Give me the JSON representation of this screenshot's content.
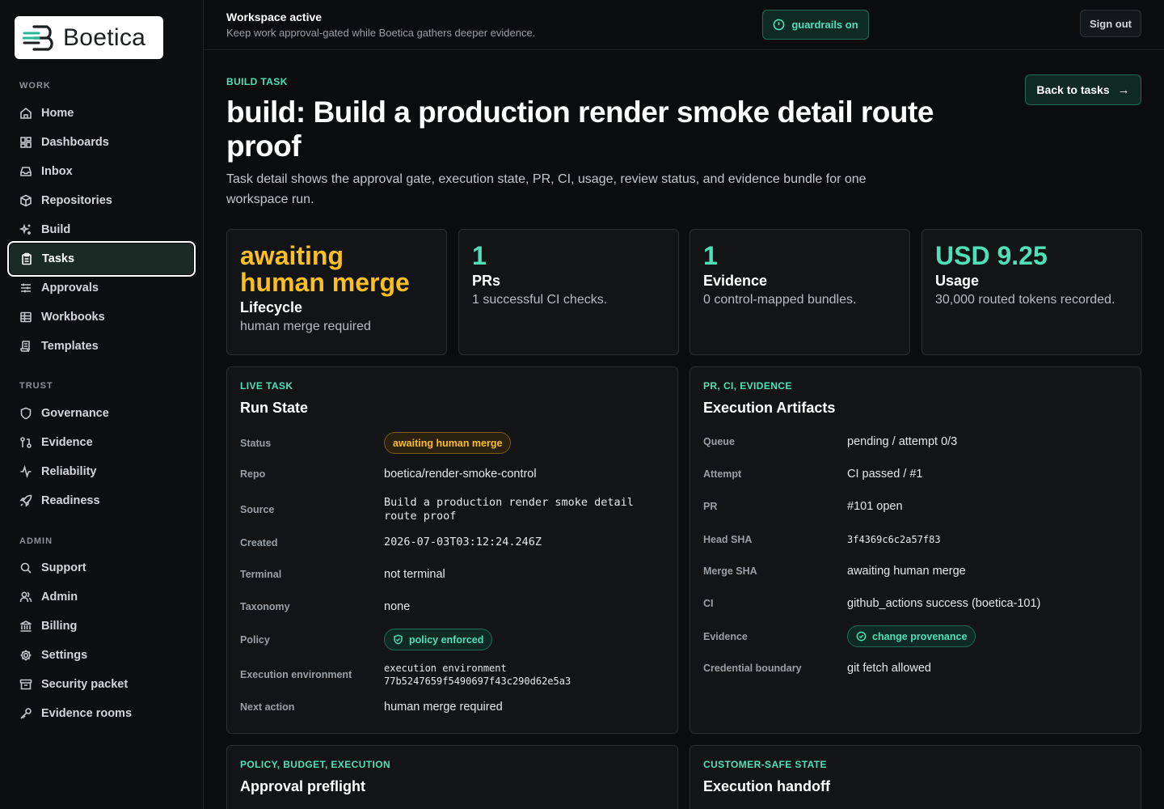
{
  "brand": {
    "name": "Boetica"
  },
  "sidebar": {
    "sections": [
      {
        "label": "WORK"
      },
      {
        "label": "TRUST"
      },
      {
        "label": "ADMIN"
      }
    ],
    "items": [
      {
        "label": "Home",
        "icon": "home-icon"
      },
      {
        "label": "Dashboards",
        "icon": "dashboard-icon"
      },
      {
        "label": "Inbox",
        "icon": "inbox-icon"
      },
      {
        "label": "Repositories",
        "icon": "box-icon"
      },
      {
        "label": "Build",
        "icon": "sparkles-icon"
      },
      {
        "label": "Tasks",
        "icon": "clipboard-icon",
        "active": true
      },
      {
        "label": "Approvals",
        "icon": "sliders-icon"
      },
      {
        "label": "Workbooks",
        "icon": "table-icon"
      },
      {
        "label": "Templates",
        "icon": "scroll-icon"
      },
      {
        "label": "Governance",
        "icon": "shield-icon"
      },
      {
        "label": "Evidence",
        "icon": "git-compare-icon"
      },
      {
        "label": "Reliability",
        "icon": "activity-icon"
      },
      {
        "label": "Readiness",
        "icon": "rocket-icon"
      },
      {
        "label": "Support",
        "icon": "search-icon"
      },
      {
        "label": "Admin",
        "icon": "users-icon"
      },
      {
        "label": "Billing",
        "icon": "landmark-icon"
      },
      {
        "label": "Settings",
        "icon": "gear-icon"
      },
      {
        "label": "Security packet",
        "icon": "archive-icon"
      },
      {
        "label": "Evidence rooms",
        "icon": "key-icon"
      }
    ]
  },
  "topbar": {
    "title": "Workspace active",
    "subtitle": "Keep work approval-gated while Boetica gathers deeper evidence.",
    "guardrails": "guardrails on",
    "signout": "Sign out"
  },
  "page": {
    "eyebrow": "BUILD TASK",
    "title": "build: Build a production render smoke detail route proof",
    "description": "Task detail shows the approval gate, execution state, PR, CI, usage, review status, and evidence bundle for one workspace run.",
    "back": "Back to tasks"
  },
  "stats": [
    {
      "value": "awaiting human merge",
      "label": "Lifecycle",
      "note": "human merge required",
      "tone": "amber"
    },
    {
      "value": "1",
      "label": "PRs",
      "note": "1 successful CI checks.",
      "tone": "teal"
    },
    {
      "value": "1",
      "label": "Evidence",
      "note": "0 control-mapped bundles.",
      "tone": "teal"
    },
    {
      "value": "USD 9.25",
      "label": "Usage",
      "note": "30,000 routed tokens recorded.",
      "tone": "teal"
    }
  ],
  "run_state": {
    "eyebrow": "LIVE TASK",
    "title": "Run State",
    "rows": [
      {
        "k": "Status",
        "v": "awaiting human merge"
      },
      {
        "k": "Repo",
        "v": "boetica/render-smoke-control"
      },
      {
        "k": "Source",
        "v": "Build a production render smoke detail route proof"
      },
      {
        "k": "Created",
        "v": "2026-07-03T03:12:24.246Z"
      },
      {
        "k": "Terminal",
        "v": "not terminal"
      },
      {
        "k": "Taxonomy",
        "v": "none"
      },
      {
        "k": "Policy",
        "v": "policy enforced"
      },
      {
        "k": "Execution environment",
        "v": "execution environment 77b5247659f5490697f43c290d62e5a3"
      },
      {
        "k": "Next action",
        "v": "human merge required"
      }
    ]
  },
  "artifacts": {
    "eyebrow": "PR, CI, EVIDENCE",
    "title": "Execution Artifacts",
    "rows": [
      {
        "k": "Queue",
        "v": "pending / attempt 0/3"
      },
      {
        "k": "Attempt",
        "v": "CI passed / #1"
      },
      {
        "k": "PR",
        "v": "#101 open"
      },
      {
        "k": "Head SHA",
        "v": "3f4369c6c2a57f83"
      },
      {
        "k": "Merge SHA",
        "v": "awaiting human merge"
      },
      {
        "k": "CI",
        "v": "github_actions success (boetica-101)"
      },
      {
        "k": "Evidence",
        "v": "change provenance"
      },
      {
        "k": "Credential boundary",
        "v": "git fetch allowed"
      }
    ]
  },
  "preflight": {
    "eyebrow": "POLICY, BUDGET, EXECUTION",
    "title": "Approval preflight"
  },
  "handoff": {
    "eyebrow": "CUSTOMER-SAFE STATE",
    "title": "Execution handoff"
  },
  "colors": {
    "accent": "#4fe0b8",
    "amber": "#fbbf24",
    "background": "#0b0c0d"
  }
}
